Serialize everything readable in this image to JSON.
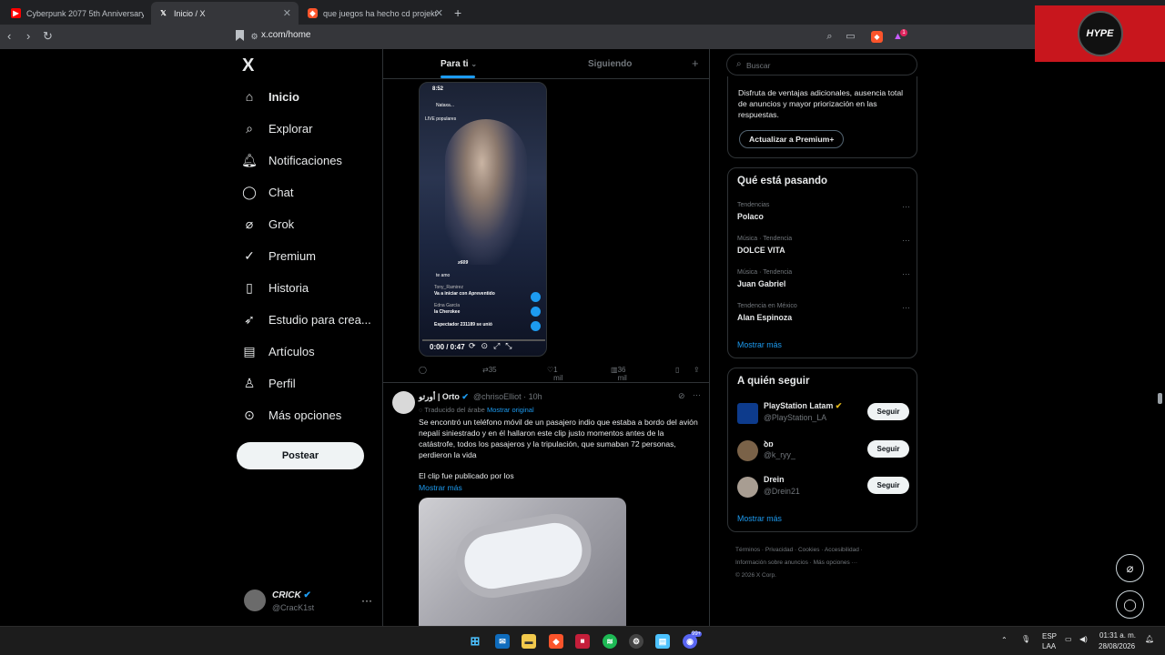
{
  "browser": {
    "tabs": [
      {
        "title": "Cyberpunk 2077 5th Anniversary Trai",
        "active": false
      },
      {
        "title": "Inicio / X",
        "active": true
      },
      {
        "title": "que juegos ha hecho cd projekt - Bra",
        "active": false
      }
    ],
    "url": "x.com/home",
    "new_tab": "+",
    "badge_count": "1",
    "overlay_logo": "HYPE"
  },
  "sidebar": {
    "logo": "X",
    "items": [
      {
        "label": "Inicio",
        "icon": "home-icon"
      },
      {
        "label": "Explorar",
        "icon": "search-icon"
      },
      {
        "label": "Notificaciones",
        "icon": "bell-icon"
      },
      {
        "label": "Chat",
        "icon": "chat-icon"
      },
      {
        "label": "Grok",
        "icon": "grok-icon"
      },
      {
        "label": "Premium",
        "icon": "premium-icon"
      },
      {
        "label": "Historia",
        "icon": "bookmark-icon"
      },
      {
        "label": "Estudio para crea...",
        "icon": "rocket-icon"
      },
      {
        "label": "Artículos",
        "icon": "article-icon"
      },
      {
        "label": "Perfil",
        "icon": "person-icon"
      },
      {
        "label": "Más opciones",
        "icon": "more-circle-icon"
      }
    ],
    "post_button": "Postear",
    "account": {
      "name": "CRICK",
      "handle": "@CracK1st",
      "more": "···"
    }
  },
  "feed": {
    "tabs": {
      "for_you": "Para ti",
      "following": "Siguiendo",
      "add": "+"
    },
    "tweet1": {
      "video_time": "0:00 / 0:47",
      "video_overlay": {
        "clock": "8:52",
        "username": "Nataxa...",
        "live_label": "LIVE populares",
        "multiplier": "x609",
        "love": "te amo",
        "commenter1": "Tony_Ramirez",
        "comment1": "Va a iniciar con Apreventido",
        "commenter2": "Edna García",
        "comment2": "la Cherokee",
        "viewer": "Espectador 231189 se unió"
      },
      "reposts": "35",
      "likes": "1 mil",
      "views": "36 mil"
    },
    "tweet2": {
      "name": "أورتو | Orto",
      "handle": "@chrisoElliot · 10h",
      "translated": "Traducido del árabe",
      "show_original": "Mostrar original",
      "text": "Se encontró un teléfono móvil de un pasajero indio que estaba a bordo del avión nepalí siniestrado y en él hallaron este clip justo momentos antes de la catástrofe, todos los pasajeros y la tripulación, que sumaban 72 personas, perdieron la vida",
      "text2": "El clip fue publicado por los",
      "show_more": "Mostrar más"
    }
  },
  "right": {
    "search_placeholder": "Buscar",
    "premium": {
      "description": "Disfruta de ventajas adicionales, ausencia total de anuncios y mayor priorización en las respuestas.",
      "button": "Actualizar a Premium+"
    },
    "trends": {
      "title": "Qué está pasando",
      "items": [
        {
          "category": "Tendencias",
          "title": "Polaco"
        },
        {
          "category": "Música · Tendencia",
          "title": "DOLCE VITA"
        },
        {
          "category": "Música · Tendencia",
          "title": "Juan Gabriel"
        },
        {
          "category": "Tendencia en México",
          "title": "Alan Espinoza"
        }
      ],
      "show_more": "Mostrar más"
    },
    "follow": {
      "title": "A quién seguir",
      "items": [
        {
          "name": "PlayStation Latam",
          "handle": "@PlayStation_LA",
          "button": "Seguir"
        },
        {
          "name": "ꝺɒ",
          "handle": "@k_ryy_",
          "button": "Seguir"
        },
        {
          "name": "Drein",
          "handle": "@Drein21",
          "button": "Seguir"
        }
      ],
      "show_more": "Mostrar más"
    },
    "footer": {
      "line1": "Términos · Privacidad · Cookies · Accesibilidad ·",
      "line2": "Información sobre anuncios · Más opciones ···",
      "line3": "© 2026 X Corp."
    }
  },
  "taskbar": {
    "lang": "ESP",
    "lang2": "LAA",
    "time": "01:31 a. m.",
    "date": "28/08/2026",
    "badge": "99+"
  },
  "colors": {
    "accent": "#1d9bf0",
    "background": "#000000",
    "border": "#2f3336",
    "muted": "#71767b"
  }
}
